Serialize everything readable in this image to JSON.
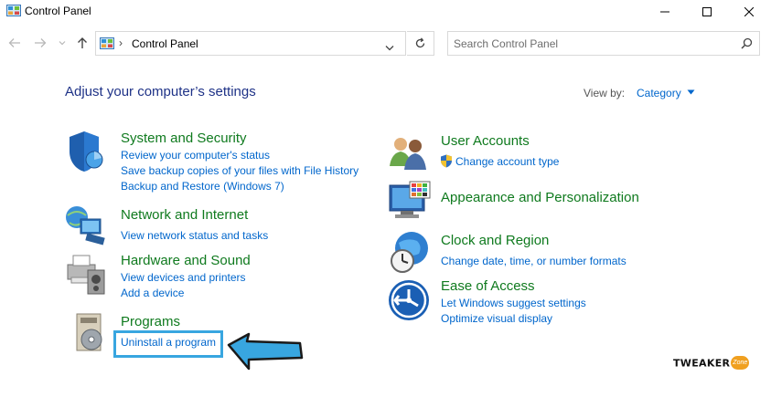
{
  "window": {
    "title": "Control Panel",
    "icon": "control-panel-icon"
  },
  "address": {
    "separator": "›",
    "location": "Control Panel",
    "search_placeholder": "Search Control Panel"
  },
  "main": {
    "heading": "Adjust your computer’s settings",
    "view_by_label": "View by:",
    "view_by_value": "Category"
  },
  "categories": {
    "system": {
      "title": "System and Security",
      "links": [
        "Review your computer's status",
        "Save backup copies of your files with File History",
        "Backup and Restore (Windows 7)"
      ],
      "icon": "shield-icon"
    },
    "network": {
      "title": "Network and Internet",
      "links": [
        "View network status and tasks"
      ],
      "icon": "network-globe-icon"
    },
    "hardware": {
      "title": "Hardware and Sound",
      "links": [
        "View devices and printers",
        "Add a device"
      ],
      "icon": "printer-speaker-icon"
    },
    "programs": {
      "title": "Programs",
      "links": [
        "Uninstall a program"
      ],
      "icon": "programs-disc-icon"
    },
    "users": {
      "title": "User Accounts",
      "links": [
        "Change account type"
      ],
      "icon": "users-icon"
    },
    "appearance": {
      "title": "Appearance and Personalization",
      "links": [],
      "icon": "monitor-palette-icon"
    },
    "clock": {
      "title": "Clock and Region",
      "links": [
        "Change date, time, or number formats"
      ],
      "icon": "clock-globe-icon"
    },
    "ease": {
      "title": "Ease of Access",
      "links": [
        "Let Windows suggest settings",
        "Optimize visual display"
      ],
      "icon": "ease-of-access-icon"
    }
  },
  "watermark": {
    "text": "TWEAKER",
    "badge": "Zone"
  },
  "colors": {
    "heading": "#1e3287",
    "category_title": "#0f7a1e",
    "link": "#0066cc",
    "highlight": "#38a6e0"
  }
}
